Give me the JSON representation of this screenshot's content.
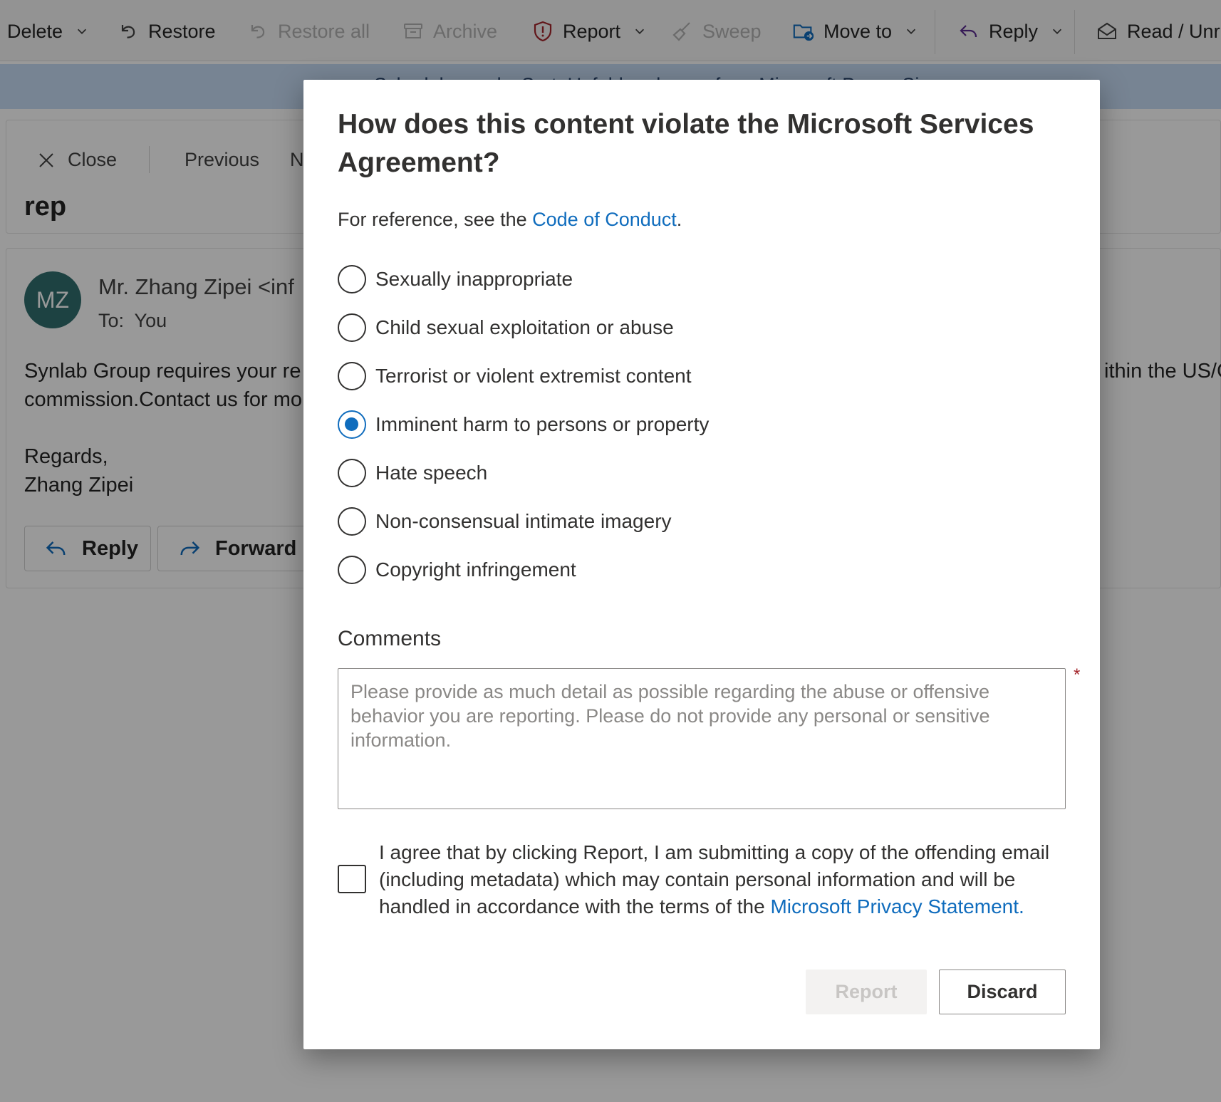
{
  "toolbar": {
    "delete_label": "Delete",
    "restore_label": "Restore",
    "restore_all_label": "Restore all",
    "archive_label": "Archive",
    "report_label": "Report",
    "sweep_label": "Sweep",
    "move_to_label": "Move to",
    "reply_label": "Reply",
    "read_unread_label": "Read / Unr"
  },
  "banner": {
    "text": "Schedule sends, Sort, Unfold and more from Microsoft Power Si"
  },
  "message_nav": {
    "close_label": "Close",
    "previous_label": "Previous",
    "next_label": "N"
  },
  "message": {
    "subject": "rep",
    "avatar_initials": "MZ",
    "sender": "Mr. Zhang Zipei <inf",
    "to_label": "To:",
    "to_value": "You",
    "body_line1": "Synlab Group requires your re",
    "body_line2": "commission.Contact us for mo",
    "body_line1_right": "ithin the US/C",
    "regards": "Regards,",
    "signature": "Zhang Zipei",
    "reply_label": "Reply",
    "forward_label": "Forward"
  },
  "dialog": {
    "title": "How does this content violate the Microsoft Services Agreement?",
    "ref_prefix": "For reference, see the ",
    "ref_link": "Code of Conduct",
    "ref_suffix": ".",
    "options": [
      {
        "label": "Sexually inappropriate",
        "checked": false
      },
      {
        "label": "Child sexual exploitation or abuse",
        "checked": false
      },
      {
        "label": "Terrorist or violent extremist content",
        "checked": false
      },
      {
        "label": "Imminent harm to persons or property",
        "checked": true
      },
      {
        "label": "Hate speech",
        "checked": false
      },
      {
        "label": "Non-consensual intimate imagery",
        "checked": false
      },
      {
        "label": "Copyright infringement",
        "checked": false
      }
    ],
    "comments_label": "Comments",
    "comments_placeholder": "Please provide as much detail as possible regarding the abuse or offensive behavior you are reporting. Please do not provide any personal or sensitive information.",
    "comments_value": "",
    "required_mark": "*",
    "agree_text": "I agree that by clicking Report, I am submitting a copy of the offending email (including metadata) which may contain personal information and will be handled in accordance with the terms of the ",
    "agree_link": "Microsoft Privacy Statement.",
    "agree_checked": false,
    "report_button": "Report",
    "report_enabled": false,
    "discard_button": "Discard"
  },
  "colors": {
    "accent": "#0f6cbd",
    "avatar": "#316e6e",
    "required": "#a4262c",
    "disabled_text": "#c8c6c4"
  }
}
